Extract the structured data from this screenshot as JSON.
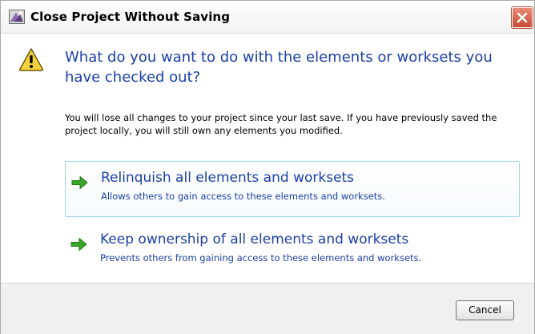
{
  "window": {
    "title": "Close Project Without Saving",
    "icons": {
      "app": "revit-app-icon",
      "close": "close-icon"
    }
  },
  "message": {
    "heading": "What do you want to do with the elements or worksets you have checked out?",
    "description": "You will lose all changes to your project since your last save. If you have previously saved the project locally, you will still own any elements you modified.",
    "icon": "warning-icon"
  },
  "options": [
    {
      "title": "Relinquish all elements and worksets",
      "subtitle": "Allows others to gain access to these elements and worksets.",
      "icon": "green-arrow-icon"
    },
    {
      "title": "Keep ownership of all elements and worksets",
      "subtitle": "Prevents others from gaining access to these elements and worksets.",
      "icon": "green-arrow-icon"
    }
  ],
  "footer": {
    "cancel_label": "Cancel"
  },
  "colors": {
    "heading": "#1a3fa8",
    "arrow": "#3aa52a",
    "warning": "#f6d23a",
    "close_button": "#c74b33",
    "hover_border": "#9fd6e8"
  }
}
